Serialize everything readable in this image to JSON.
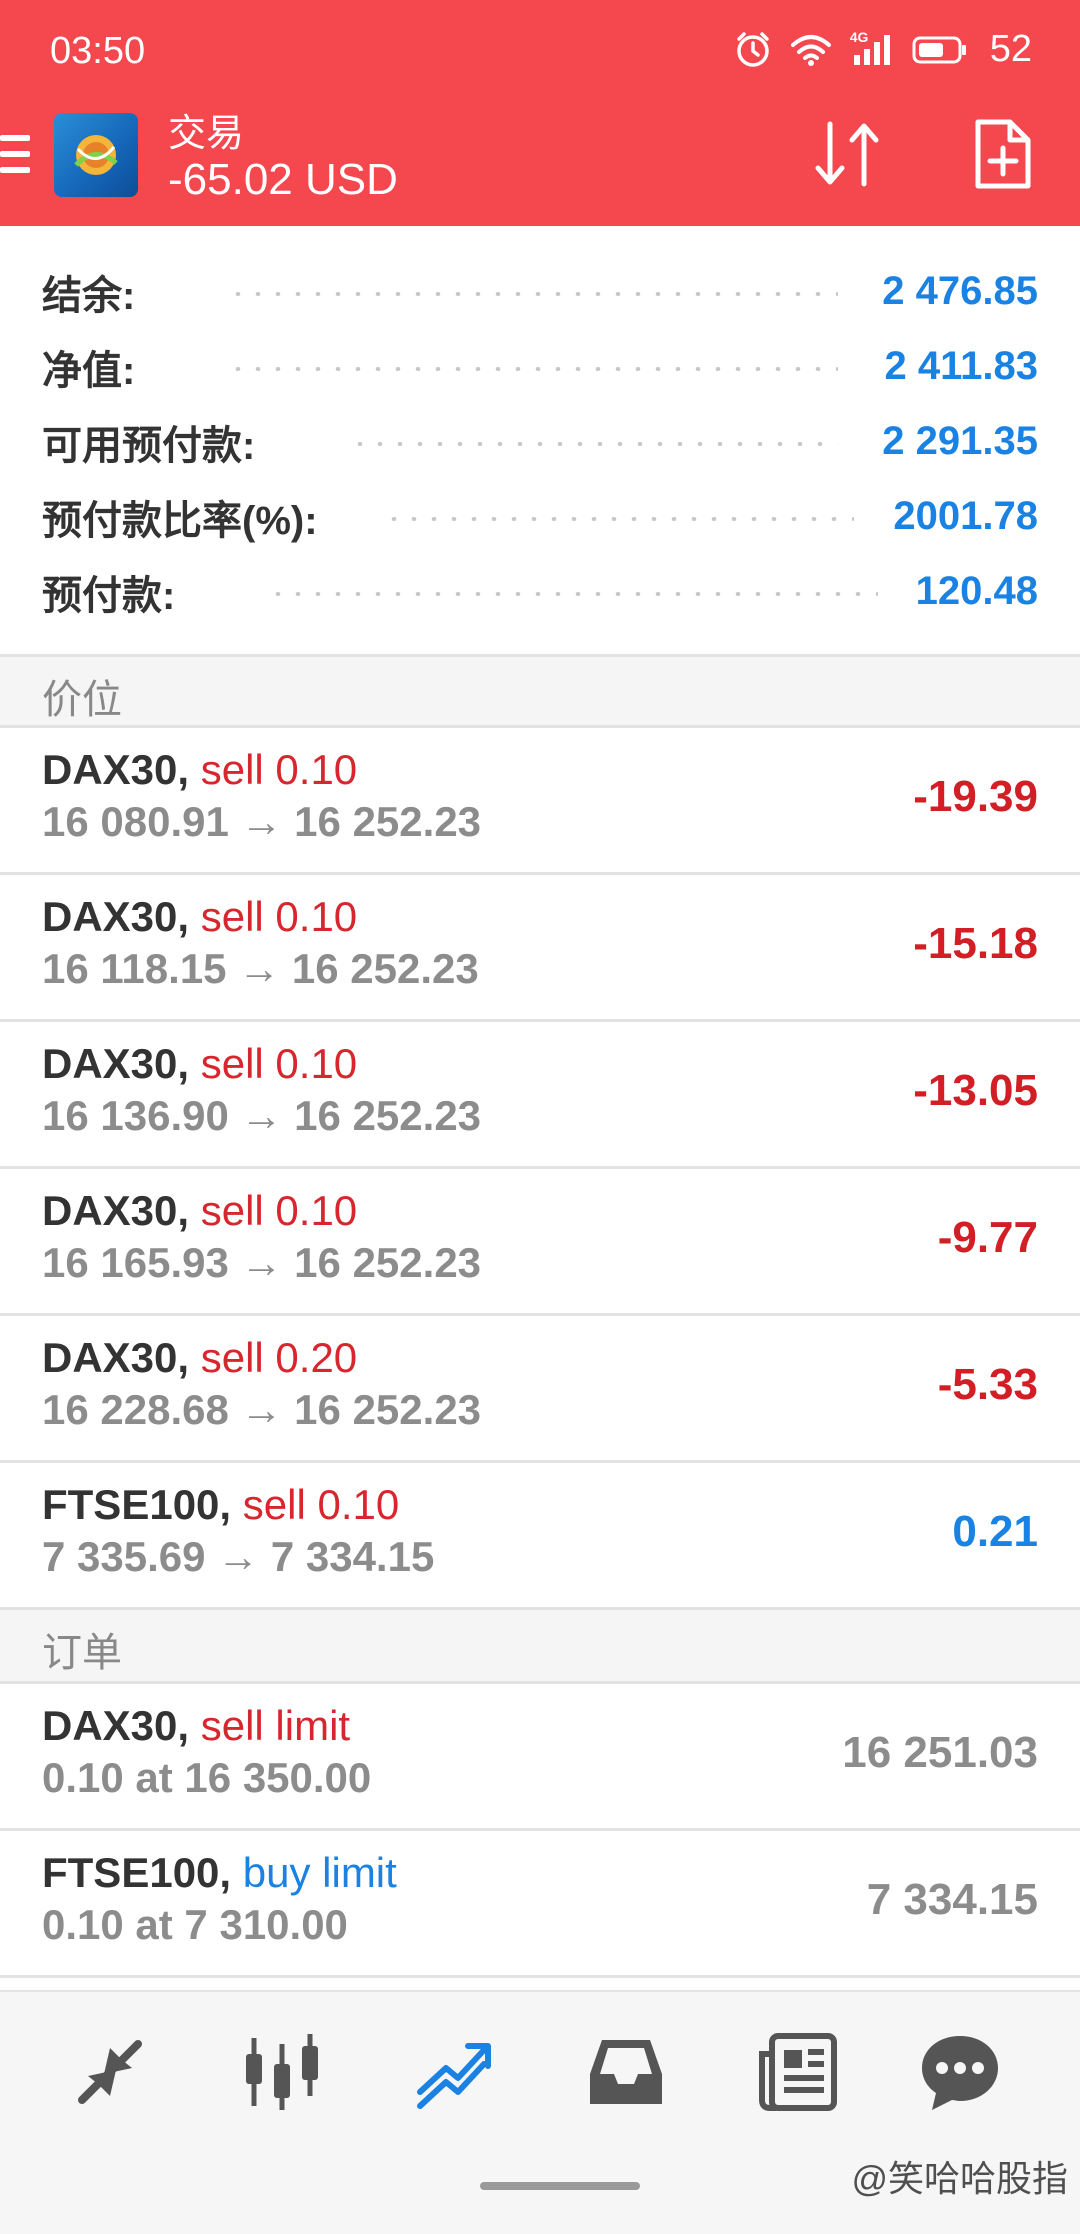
{
  "status_bar": {
    "time": "03:50",
    "network": "4G",
    "battery": "52"
  },
  "header": {
    "title": "交易",
    "subtitle": "-65.02 USD"
  },
  "summary": [
    {
      "label": "结余:",
      "value": "2 476.85"
    },
    {
      "label": "净值:",
      "value": "2 411.83"
    },
    {
      "label": "可用预付款:",
      "value": "2 291.35"
    },
    {
      "label": "预付款比率(%):",
      "value": "2001.78"
    },
    {
      "label": "预付款:",
      "value": "120.48"
    }
  ],
  "positions": {
    "title": "价位",
    "items": [
      {
        "symbol": "DAX30,",
        "side": "sell 0.10",
        "prices": "16 080.91 → 16 252.23",
        "profit": "-19.39"
      },
      {
        "symbol": "DAX30,",
        "side": "sell 0.10",
        "prices": "16 118.15 → 16 252.23",
        "profit": "-15.18"
      },
      {
        "symbol": "DAX30,",
        "side": "sell 0.10",
        "prices": "16 136.90 → 16 252.23",
        "profit": "-13.05"
      },
      {
        "symbol": "DAX30,",
        "side": "sell 0.10",
        "prices": "16 165.93 → 16 252.23",
        "profit": "-9.77"
      },
      {
        "symbol": "DAX30,",
        "side": "sell 0.20",
        "prices": "16 228.68 → 16 252.23",
        "profit": "-5.33"
      },
      {
        "symbol": "FTSE100,",
        "side": "sell 0.10",
        "prices": "7 335.69 → 7 334.15",
        "profit": "0.21"
      }
    ]
  },
  "orders": {
    "title": "订单",
    "items": [
      {
        "symbol": "DAX30,",
        "side": "sell limit",
        "detail": "0.10 at 16 350.00",
        "price": "16 251.03"
      },
      {
        "symbol": "FTSE100,",
        "side": "buy limit",
        "detail": "0.10 at 7 310.00",
        "price": "7 334.15"
      }
    ]
  },
  "bottom_nav": {
    "items": [
      "quotes-icon",
      "chart-icon",
      "trade-icon",
      "history-icon",
      "news-icon",
      "chat-icon"
    ],
    "active_color": "#1a82e2",
    "inactive_color": "#555555"
  },
  "watermark": "@笑哈哈股指",
  "colors": {
    "header_bg": "#f5474e",
    "value_blue": "#1a82e2",
    "loss_red": "#d21f26"
  }
}
